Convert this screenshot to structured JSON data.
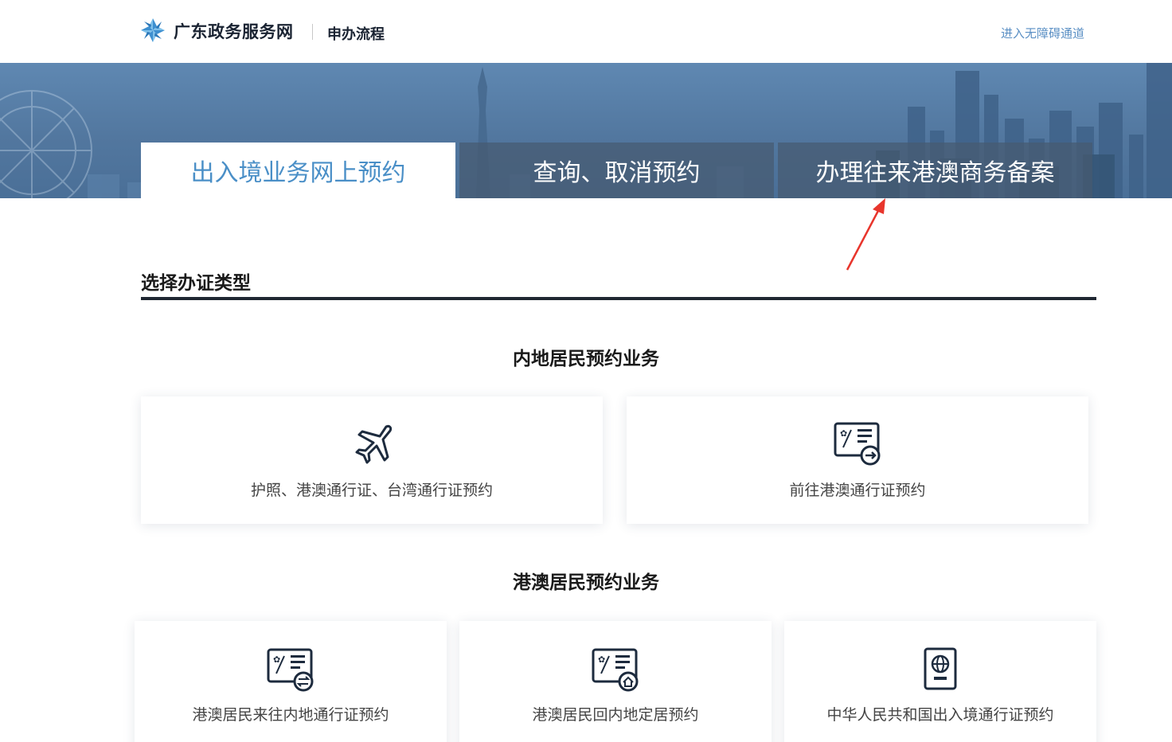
{
  "header": {
    "site_name": "广东政务服务网",
    "process_link": "申办流程",
    "accessibility_link": "进入无障碍通道"
  },
  "tabs": [
    {
      "label": "出入境业务网上预约",
      "active": true
    },
    {
      "label": "查询、取消预约",
      "active": false
    },
    {
      "label": "办理往来港澳商务备案",
      "active": false
    }
  ],
  "section": {
    "title": "选择办证类型"
  },
  "groups": [
    {
      "title": "内地居民预约业务",
      "cards": [
        {
          "label": "护照、港澳通行证、台湾通行证预约",
          "icon": "airplane-icon"
        },
        {
          "label": "前往港澳通行证预约",
          "icon": "hk-permit-outbound-icon"
        }
      ]
    },
    {
      "title": "港澳居民预约业务",
      "cards": [
        {
          "label": "港澳居民来往内地通行证预约",
          "icon": "hk-permit-exchange-icon"
        },
        {
          "label": "港澳居民回内地定居预约",
          "icon": "hk-permit-home-icon"
        },
        {
          "label": "中华人民共和国出入境通行证预约",
          "icon": "passport-icon"
        }
      ]
    }
  ],
  "colors": {
    "accent": "#4a8fc7",
    "link": "#5a8fc4",
    "annotation_arrow": "#e8352c"
  }
}
